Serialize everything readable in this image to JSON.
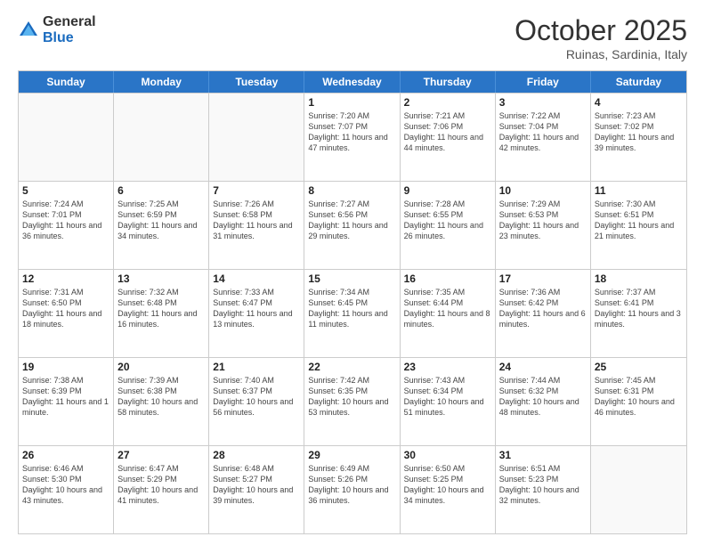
{
  "logo": {
    "general": "General",
    "blue": "Blue"
  },
  "title": "October 2025",
  "location": "Ruinas, Sardinia, Italy",
  "days_of_week": [
    "Sunday",
    "Monday",
    "Tuesday",
    "Wednesday",
    "Thursday",
    "Friday",
    "Saturday"
  ],
  "rows": [
    [
      {
        "day": "",
        "empty": true
      },
      {
        "day": "",
        "empty": true
      },
      {
        "day": "",
        "empty": true
      },
      {
        "day": "1",
        "sunrise": "7:20 AM",
        "sunset": "7:07 PM",
        "daylight": "11 hours and 47 minutes."
      },
      {
        "day": "2",
        "sunrise": "7:21 AM",
        "sunset": "7:06 PM",
        "daylight": "11 hours and 44 minutes."
      },
      {
        "day": "3",
        "sunrise": "7:22 AM",
        "sunset": "7:04 PM",
        "daylight": "11 hours and 42 minutes."
      },
      {
        "day": "4",
        "sunrise": "7:23 AM",
        "sunset": "7:02 PM",
        "daylight": "11 hours and 39 minutes."
      }
    ],
    [
      {
        "day": "5",
        "sunrise": "7:24 AM",
        "sunset": "7:01 PM",
        "daylight": "11 hours and 36 minutes."
      },
      {
        "day": "6",
        "sunrise": "7:25 AM",
        "sunset": "6:59 PM",
        "daylight": "11 hours and 34 minutes."
      },
      {
        "day": "7",
        "sunrise": "7:26 AM",
        "sunset": "6:58 PM",
        "daylight": "11 hours and 31 minutes."
      },
      {
        "day": "8",
        "sunrise": "7:27 AM",
        "sunset": "6:56 PM",
        "daylight": "11 hours and 29 minutes."
      },
      {
        "day": "9",
        "sunrise": "7:28 AM",
        "sunset": "6:55 PM",
        "daylight": "11 hours and 26 minutes."
      },
      {
        "day": "10",
        "sunrise": "7:29 AM",
        "sunset": "6:53 PM",
        "daylight": "11 hours and 23 minutes."
      },
      {
        "day": "11",
        "sunrise": "7:30 AM",
        "sunset": "6:51 PM",
        "daylight": "11 hours and 21 minutes."
      }
    ],
    [
      {
        "day": "12",
        "sunrise": "7:31 AM",
        "sunset": "6:50 PM",
        "daylight": "11 hours and 18 minutes."
      },
      {
        "day": "13",
        "sunrise": "7:32 AM",
        "sunset": "6:48 PM",
        "daylight": "11 hours and 16 minutes."
      },
      {
        "day": "14",
        "sunrise": "7:33 AM",
        "sunset": "6:47 PM",
        "daylight": "11 hours and 13 minutes."
      },
      {
        "day": "15",
        "sunrise": "7:34 AM",
        "sunset": "6:45 PM",
        "daylight": "11 hours and 11 minutes."
      },
      {
        "day": "16",
        "sunrise": "7:35 AM",
        "sunset": "6:44 PM",
        "daylight": "11 hours and 8 minutes."
      },
      {
        "day": "17",
        "sunrise": "7:36 AM",
        "sunset": "6:42 PM",
        "daylight": "11 hours and 6 minutes."
      },
      {
        "day": "18",
        "sunrise": "7:37 AM",
        "sunset": "6:41 PM",
        "daylight": "11 hours and 3 minutes."
      }
    ],
    [
      {
        "day": "19",
        "sunrise": "7:38 AM",
        "sunset": "6:39 PM",
        "daylight": "11 hours and 1 minute."
      },
      {
        "day": "20",
        "sunrise": "7:39 AM",
        "sunset": "6:38 PM",
        "daylight": "10 hours and 58 minutes."
      },
      {
        "day": "21",
        "sunrise": "7:40 AM",
        "sunset": "6:37 PM",
        "daylight": "10 hours and 56 minutes."
      },
      {
        "day": "22",
        "sunrise": "7:42 AM",
        "sunset": "6:35 PM",
        "daylight": "10 hours and 53 minutes."
      },
      {
        "day": "23",
        "sunrise": "7:43 AM",
        "sunset": "6:34 PM",
        "daylight": "10 hours and 51 minutes."
      },
      {
        "day": "24",
        "sunrise": "7:44 AM",
        "sunset": "6:32 PM",
        "daylight": "10 hours and 48 minutes."
      },
      {
        "day": "25",
        "sunrise": "7:45 AM",
        "sunset": "6:31 PM",
        "daylight": "10 hours and 46 minutes."
      }
    ],
    [
      {
        "day": "26",
        "sunrise": "6:46 AM",
        "sunset": "5:30 PM",
        "daylight": "10 hours and 43 minutes."
      },
      {
        "day": "27",
        "sunrise": "6:47 AM",
        "sunset": "5:29 PM",
        "daylight": "10 hours and 41 minutes."
      },
      {
        "day": "28",
        "sunrise": "6:48 AM",
        "sunset": "5:27 PM",
        "daylight": "10 hours and 39 minutes."
      },
      {
        "day": "29",
        "sunrise": "6:49 AM",
        "sunset": "5:26 PM",
        "daylight": "10 hours and 36 minutes."
      },
      {
        "day": "30",
        "sunrise": "6:50 AM",
        "sunset": "5:25 PM",
        "daylight": "10 hours and 34 minutes."
      },
      {
        "day": "31",
        "sunrise": "6:51 AM",
        "sunset": "5:23 PM",
        "daylight": "10 hours and 32 minutes."
      },
      {
        "day": "",
        "empty": true
      }
    ]
  ]
}
